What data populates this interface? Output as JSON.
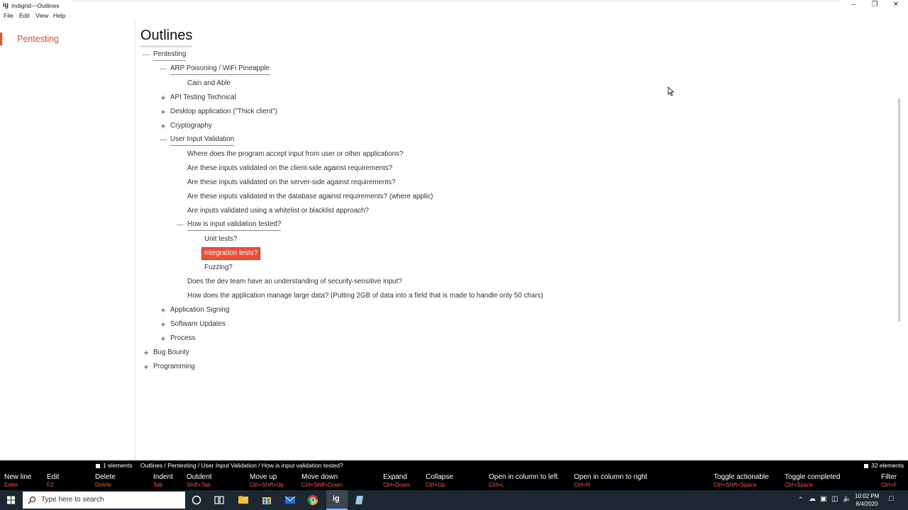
{
  "window": {
    "logo": "ig",
    "title": "Indigrid—Outlines",
    "controls": [
      "minimize",
      "restore",
      "close"
    ]
  },
  "menu": [
    "File",
    "Edit",
    "View",
    "Help"
  ],
  "sidebar": {
    "items": [
      "Pentesting"
    ]
  },
  "main": {
    "title": "Outlines",
    "outline": [
      {
        "text": "Pentesting",
        "level": 0,
        "toggle": "minus",
        "underline": true
      },
      {
        "text": "ARP Poisoning / WiFi Pineapple",
        "level": 1,
        "toggle": "minus",
        "underline": true
      },
      {
        "text": "Cain and Able",
        "level": 2,
        "toggle": ""
      },
      {
        "text": "API Testing Technical",
        "level": 1,
        "toggle": "plus"
      },
      {
        "text": "Desktop application (\"Thick client\")",
        "level": 1,
        "toggle": "plus"
      },
      {
        "text": "Cryptography",
        "level": 1,
        "toggle": "plus"
      },
      {
        "text": "User Input Validation",
        "level": 1,
        "toggle": "minus",
        "underline": true
      },
      {
        "text": "Where does the program accept input from user or other applications?",
        "level": 2,
        "toggle": ""
      },
      {
        "text": "Are these inputs validated on the client-side against requirements?",
        "level": 2,
        "toggle": ""
      },
      {
        "text": "Are these inputs validated on the server-side against requirements?",
        "level": 2,
        "toggle": ""
      },
      {
        "text": "Are these inputs validated in the database against requirements? (where applic)",
        "level": 2,
        "toggle": ""
      },
      {
        "text": "Are inputs validated using a whitelist or blacklist approach?",
        "level": 2,
        "toggle": ""
      },
      {
        "text": "How is input validation tested?",
        "level": 2,
        "toggle": "minus",
        "underline": true
      },
      {
        "text": "Unit tests?",
        "level": 3,
        "toggle": ""
      },
      {
        "text": "Integration tests?",
        "level": 3,
        "toggle": "",
        "selected": true
      },
      {
        "text": "Fuzzing?",
        "level": 3,
        "toggle": ""
      },
      {
        "text": "Does the dev team have an understanding of security-sensitive input?",
        "level": 2,
        "toggle": ""
      },
      {
        "text": "How does the application manage large data? (Putting 2GB of data into a field that is made to handle only 50 chars)",
        "level": 2,
        "toggle": ""
      },
      {
        "text": "Application Signing",
        "level": 1,
        "toggle": "plus"
      },
      {
        "text": "Software Updates",
        "level": 1,
        "toggle": "plus"
      },
      {
        "text": "Process",
        "level": 1,
        "toggle": "plus"
      },
      {
        "text": "Bug Bounty",
        "level": 0,
        "toggle": "plus"
      },
      {
        "text": "Programming",
        "level": 0,
        "toggle": "plus"
      }
    ]
  },
  "status": {
    "selected": "1 elements",
    "breadcrumb": "Outlines / Pentesting / User Input Validation / How is input validation tested?",
    "count": "32 elements"
  },
  "shortcuts": [
    {
      "label": "New line",
      "key": "Enter"
    },
    {
      "label": "Edit",
      "key": "F2"
    },
    {
      "label": "Delete",
      "key": "Delete"
    },
    {
      "label": "Indent",
      "key": "Tab"
    },
    {
      "label": "Outdent",
      "key": "Shift+Tab"
    },
    {
      "label": "Move up",
      "key": "Ctrl+Shift+Up"
    },
    {
      "label": "Move down",
      "key": "Ctrl+Shift+Down"
    },
    {
      "label": "Expand",
      "key": "Ctrl+Down"
    },
    {
      "label": "Collapse",
      "key": "Ctrl+Up"
    },
    {
      "label": "Open in column to left",
      "key": "Ctrl+L"
    },
    {
      "label": "Open in column to right",
      "key": "Ctrl+R"
    },
    {
      "label": "Toggle actionable",
      "key": "Ctrl+Shift+Space"
    },
    {
      "label": "Toggle completed",
      "key": "Ctrl+Space"
    },
    {
      "label": "Filter",
      "key": "Ctrl+F"
    }
  ],
  "taskbar": {
    "search_placeholder": "Type here to search",
    "time": "10:02 PM",
    "date": "8/4/2020"
  },
  "colors": {
    "accent": "#e8503a",
    "bar": "#000000",
    "taskbar": "#1d2731"
  }
}
